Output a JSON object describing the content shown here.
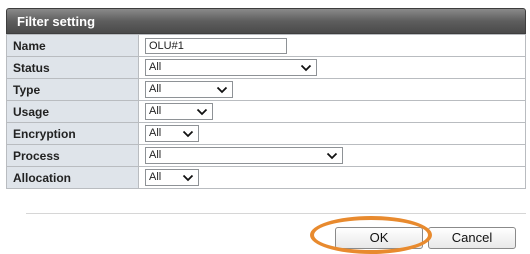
{
  "dialog": {
    "title": "Filter setting"
  },
  "fields": {
    "name": {
      "label": "Name",
      "value": "OLU#1"
    },
    "status": {
      "label": "Status",
      "value": "All"
    },
    "type": {
      "label": "Type",
      "value": "All"
    },
    "usage": {
      "label": "Usage",
      "value": "All"
    },
    "encryption": {
      "label": "Encryption",
      "value": "All"
    },
    "process": {
      "label": "Process",
      "value": "All"
    },
    "allocation": {
      "label": "Allocation",
      "value": "All"
    }
  },
  "buttons": {
    "ok": "OK",
    "cancel": "Cancel"
  },
  "colors": {
    "titlebar": "#5e5e5e",
    "label_bg": "#dfe4ea",
    "highlight": "#e88a2e"
  },
  "icons": {
    "dropdown": "chevron-down-icon"
  }
}
